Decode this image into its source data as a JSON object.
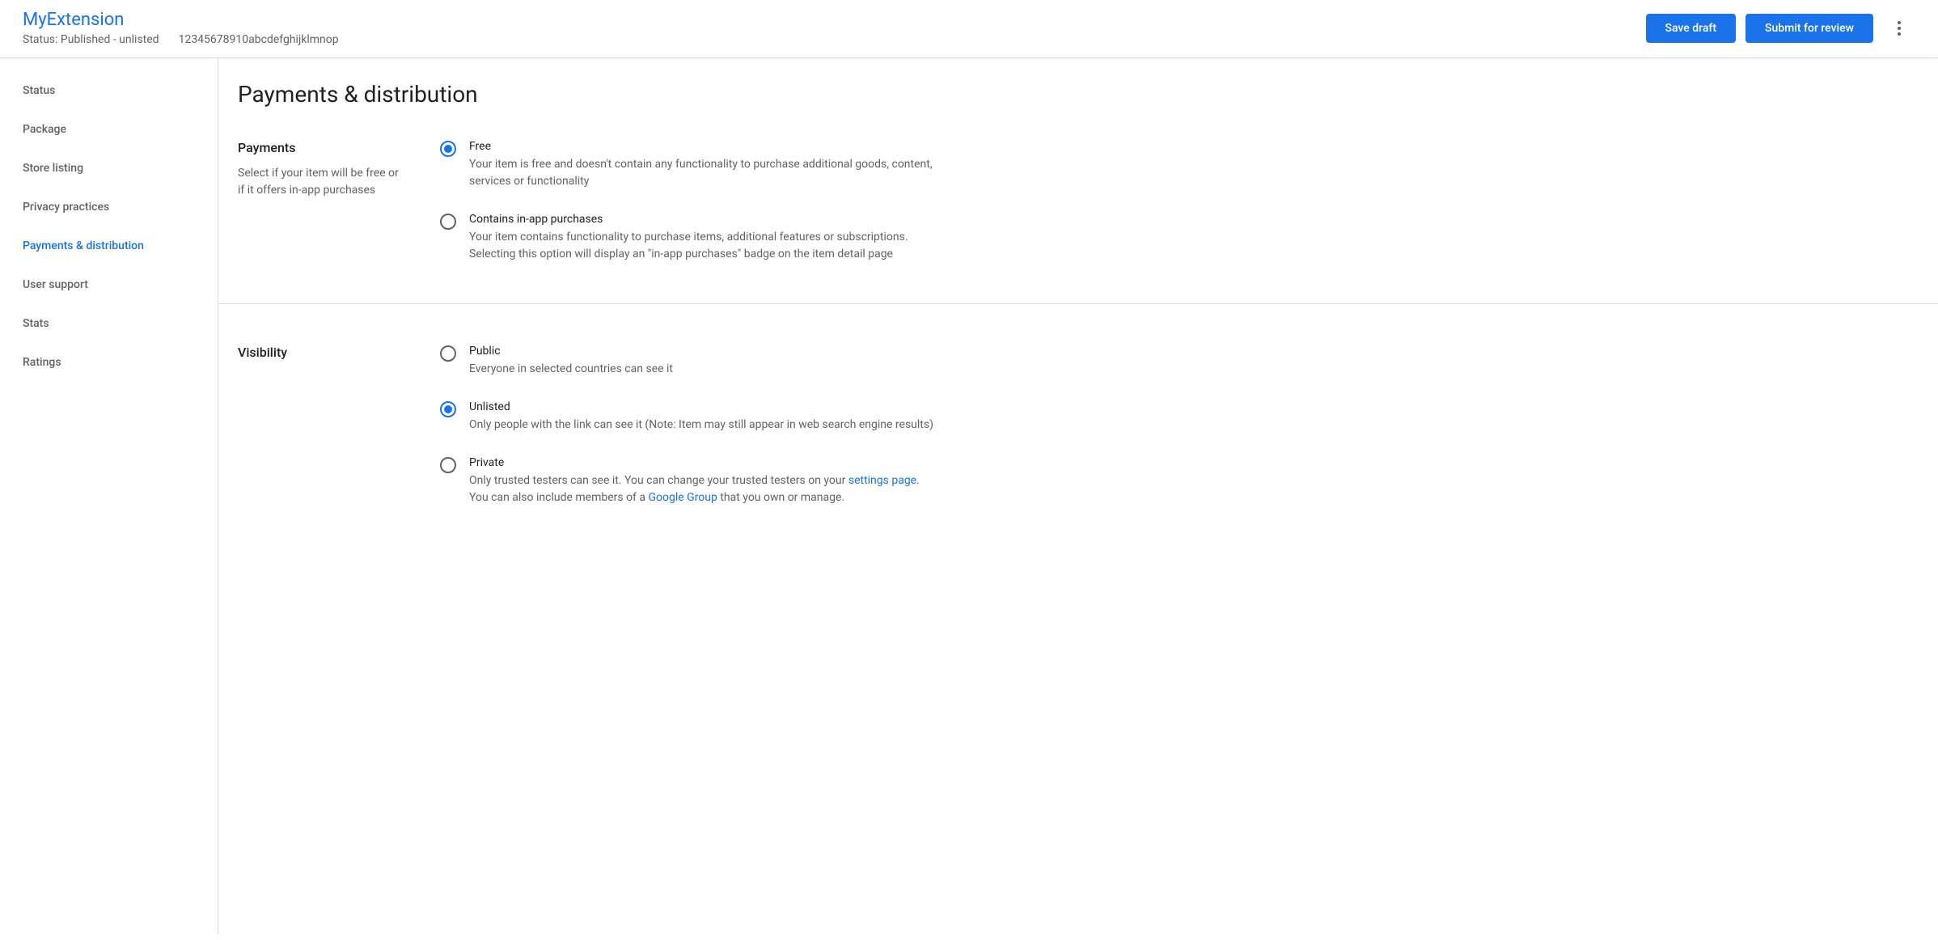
{
  "header": {
    "title": "MyExtension",
    "status": "Status: Published - unlisted",
    "id": "12345678910abcdefghijklmnop",
    "save_draft": "Save draft",
    "submit": "Submit for review"
  },
  "sidebar": {
    "items": [
      {
        "label": "Status"
      },
      {
        "label": "Package"
      },
      {
        "label": "Store listing"
      },
      {
        "label": "Privacy practices"
      },
      {
        "label": "Payments & distribution"
      },
      {
        "label": "User support"
      },
      {
        "label": "Stats"
      },
      {
        "label": "Ratings"
      }
    ]
  },
  "main": {
    "title": "Payments & distribution",
    "payments": {
      "title": "Payments",
      "desc": "Select if your item will be free or if it offers in-app purchases",
      "options": [
        {
          "label": "Free",
          "desc": "Your item is free and doesn't contain any functionality to purchase additional goods, content, services or functionality"
        },
        {
          "label": "Contains in-app purchases",
          "desc": "Your item contains functionality to purchase items, additional features or subscriptions. Selecting this option will display an \"in-app purchases\" badge on the item detail page"
        }
      ]
    },
    "visibility": {
      "title": "Visibility",
      "options": [
        {
          "label": "Public",
          "desc": "Everyone in selected countries can see it"
        },
        {
          "label": "Unlisted",
          "desc": "Only people with the link can see it (Note: Item may still appear in web search engine results)"
        },
        {
          "label": "Private",
          "desc1": "Only trusted testers can see it. You can change your trusted testers on your ",
          "link1": "settings page",
          "desc2": ".",
          "desc3": "You can also include members of a ",
          "link2": "Google Group",
          "desc4": " that you own or manage."
        }
      ]
    }
  }
}
